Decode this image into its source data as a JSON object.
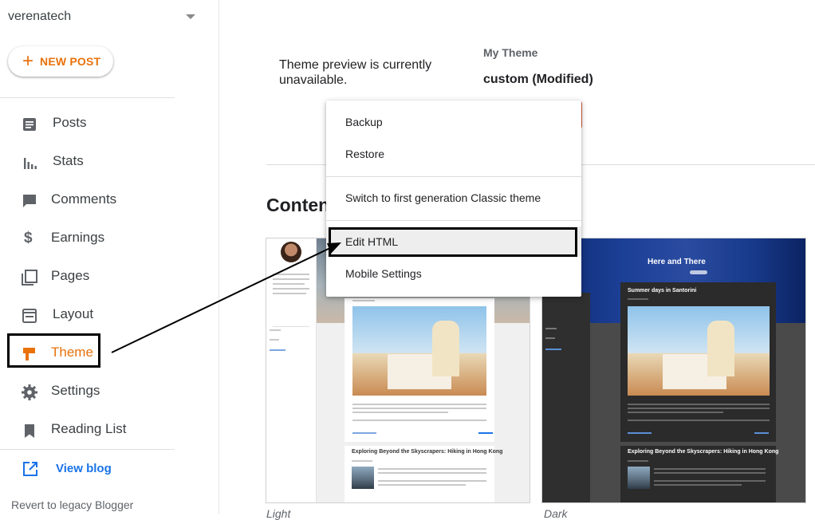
{
  "sidebar": {
    "blog_name": "verenatech",
    "new_post_label": "NEW POST",
    "items": [
      {
        "label": "Posts",
        "icon": "posts-icon"
      },
      {
        "label": "Stats",
        "icon": "stats-icon"
      },
      {
        "label": "Comments",
        "icon": "comments-icon"
      },
      {
        "label": "Earnings",
        "icon": "dollar-icon"
      },
      {
        "label": "Pages",
        "icon": "pages-icon"
      },
      {
        "label": "Layout",
        "icon": "layout-icon"
      },
      {
        "label": "Theme",
        "icon": "theme-icon",
        "active": true
      },
      {
        "label": "Settings",
        "icon": "gear-icon"
      },
      {
        "label": "Reading List",
        "icon": "bookmark-icon"
      }
    ],
    "view_blog_label": "View blog",
    "revert_label": "Revert to legacy Blogger"
  },
  "main": {
    "preview_message": "Theme preview is currently unavailable.",
    "my_theme_caption": "My Theme",
    "theme_name": "custom (Modified)",
    "section_title": "Conten",
    "cards": [
      {
        "caption": "Light",
        "post1_title": "Exploring Beyond the Skyscrapers: Hiking in Hong Kong"
      },
      {
        "caption": "Dark",
        "header_title": "Here and There",
        "post_title": "Summer days in Santorini",
        "post2_title": "Exploring Beyond the Skyscrapers: Hiking in Hong Kong"
      }
    ]
  },
  "menu": {
    "items": [
      {
        "label": "Backup"
      },
      {
        "label": "Restore"
      },
      {
        "label": "Switch to first generation Classic theme"
      },
      {
        "label": "Edit HTML",
        "highlighted": true
      },
      {
        "label": "Mobile Settings"
      }
    ]
  },
  "colors": {
    "accent": "#e8710a",
    "link": "#1a73e8",
    "annotation": "#000000"
  }
}
